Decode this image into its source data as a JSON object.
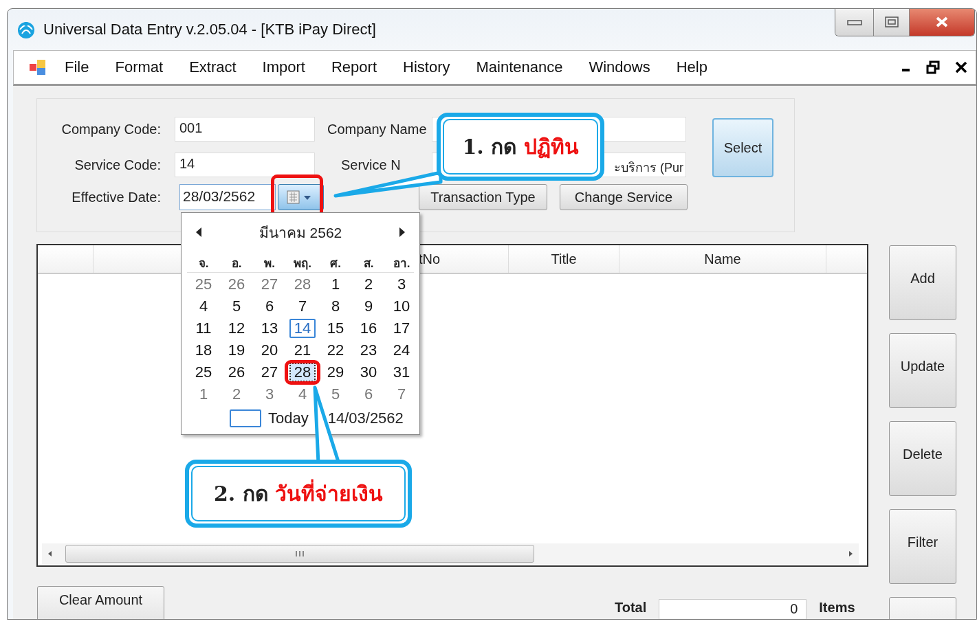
{
  "window": {
    "title": "Universal Data Entry v.2.05.04 - [KTB iPay Direct]"
  },
  "menu": [
    "File",
    "Format",
    "Extract",
    "Import",
    "Report",
    "History",
    "Maintenance",
    "Windows",
    "Help"
  ],
  "form": {
    "fields": [
      {
        "label": "Company Code:",
        "value": "001"
      },
      {
        "label": "Service Code:",
        "value": "14"
      }
    ],
    "name_fields": [
      {
        "label": "Company Name"
      },
      {
        "label": "Service N",
        "value": "ะบริการ (Pur"
      }
    ],
    "effective_date": {
      "label": "Effective Date:",
      "value": "28/03/2562"
    },
    "buttons": [
      "Transaction Type",
      "Change Service"
    ],
    "select_button": "Select"
  },
  "calendar": {
    "month": "มีนาคม 2562",
    "weekdays": [
      "จ.",
      "อ.",
      "พ.",
      "พฤ.",
      "ศ.",
      "ส.",
      "อา."
    ],
    "weeks": [
      [
        {
          "day": "25",
          "other_month": true,
          "today": false,
          "selected": false
        },
        {
          "day": "26",
          "other_month": true,
          "today": false,
          "selected": false
        },
        {
          "day": "27",
          "other_month": true,
          "today": false,
          "selected": false
        },
        {
          "day": "28",
          "other_month": true,
          "today": false,
          "selected": false
        },
        {
          "day": "1",
          "other_month": false,
          "today": false,
          "selected": false
        },
        {
          "day": "2",
          "other_month": false,
          "today": false,
          "selected": false
        },
        {
          "day": "3",
          "other_month": false,
          "today": false,
          "selected": false
        }
      ],
      [
        {
          "day": "4",
          "other_month": false,
          "today": false,
          "selected": false
        },
        {
          "day": "5",
          "other_month": false,
          "today": false,
          "selected": false
        },
        {
          "day": "6",
          "other_month": false,
          "today": false,
          "selected": false
        },
        {
          "day": "7",
          "other_month": false,
          "today": false,
          "selected": false
        },
        {
          "day": "8",
          "other_month": false,
          "today": false,
          "selected": false
        },
        {
          "day": "9",
          "other_month": false,
          "today": false,
          "selected": false
        },
        {
          "day": "10",
          "other_month": false,
          "today": false,
          "selected": false
        }
      ],
      [
        {
          "day": "11",
          "other_month": false,
          "today": false,
          "selected": false
        },
        {
          "day": "12",
          "other_month": false,
          "today": false,
          "selected": false
        },
        {
          "day": "13",
          "other_month": false,
          "today": false,
          "selected": false
        },
        {
          "day": "14",
          "other_month": false,
          "today": true,
          "selected": false
        },
        {
          "day": "15",
          "other_month": false,
          "today": false,
          "selected": false
        },
        {
          "day": "16",
          "other_month": false,
          "today": false,
          "selected": false
        },
        {
          "day": "17",
          "other_month": false,
          "today": false,
          "selected": false
        }
      ],
      [
        {
          "day": "18",
          "other_month": false,
          "today": false,
          "selected": false
        },
        {
          "day": "19",
          "other_month": false,
          "today": false,
          "selected": false
        },
        {
          "day": "20",
          "other_month": false,
          "today": false,
          "selected": false
        },
        {
          "day": "21",
          "other_month": false,
          "today": false,
          "selected": false
        },
        {
          "day": "22",
          "other_month": false,
          "today": false,
          "selected": false
        },
        {
          "day": "23",
          "other_month": false,
          "today": false,
          "selected": false
        },
        {
          "day": "24",
          "other_month": false,
          "today": false,
          "selected": false
        }
      ],
      [
        {
          "day": "25",
          "other_month": false,
          "today": false,
          "selected": false
        },
        {
          "day": "26",
          "other_month": false,
          "today": false,
          "selected": false
        },
        {
          "day": "27",
          "other_month": false,
          "today": false,
          "selected": false
        },
        {
          "day": "28",
          "other_month": false,
          "today": false,
          "selected": true
        },
        {
          "day": "29",
          "other_month": false,
          "today": false,
          "selected": false
        },
        {
          "day": "30",
          "other_month": false,
          "today": false,
          "selected": false
        },
        {
          "day": "31",
          "other_month": false,
          "today": false,
          "selected": false
        }
      ],
      [
        {
          "day": "1",
          "other_month": true,
          "today": false,
          "selected": false
        },
        {
          "day": "2",
          "other_month": true,
          "today": false,
          "selected": false
        },
        {
          "day": "3",
          "other_month": true,
          "today": false,
          "selected": false
        },
        {
          "day": "4",
          "other_month": true,
          "today": false,
          "selected": false
        },
        {
          "day": "5",
          "other_month": true,
          "today": false,
          "selected": false
        },
        {
          "day": "6",
          "other_month": true,
          "today": false,
          "selected": false
        },
        {
          "day": "7",
          "other_month": true,
          "today": false,
          "selected": false
        }
      ]
    ],
    "today_word": "Today",
    "today_date": "14/03/2562"
  },
  "table": {
    "columns": [
      "tNo",
      "Title",
      "Name"
    ]
  },
  "side_buttons": [
    "Add",
    "Update",
    "Delete",
    "Filter"
  ],
  "footer": {
    "clear_button": "Clear Amount",
    "total_label": "Total",
    "total_value": "0",
    "items_label": "Items"
  },
  "callouts": [
    {
      "step": "1. กด",
      "highlight": "ปฏิทิน"
    },
    {
      "step": "2. กด",
      "highlight": "วันที่จ่ายเงิน"
    }
  ]
}
